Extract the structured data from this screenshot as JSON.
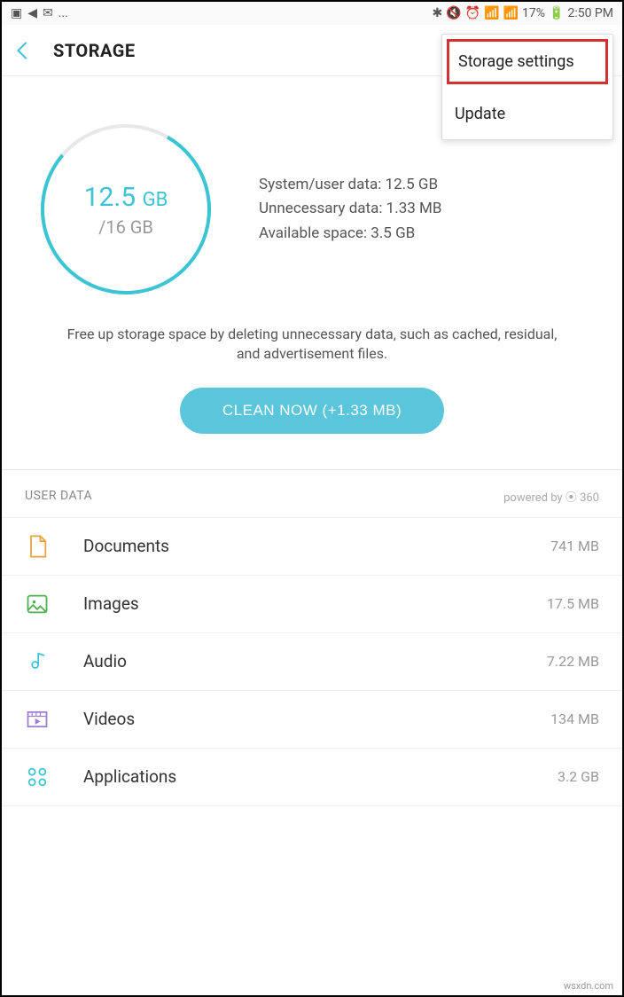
{
  "status_bar": {
    "battery_percent": "17%",
    "time": "2:50 PM"
  },
  "header": {
    "title": "STORAGE"
  },
  "popup": {
    "storage_settings": "Storage settings",
    "update": "Update"
  },
  "storage": {
    "used": "12.5",
    "used_unit": "GB",
    "total": "/16 GB",
    "system_label": "System/user data: 12.5 GB",
    "unnecessary_label": "Unnecessary data: 1.33 MB",
    "available_label": "Available space: 3.5 GB"
  },
  "hint": "Free up storage space by deleting unnecessary data, such as cached, residual, and advertisement files.",
  "clean_button": "CLEAN NOW (+1.33 MB)",
  "section": {
    "title": "USER DATA",
    "powered_by": "powered by ⦿ 360"
  },
  "user_data": [
    {
      "label": "Documents",
      "size": "741 MB"
    },
    {
      "label": "Images",
      "size": "17.5 MB"
    },
    {
      "label": "Audio",
      "size": "7.22 MB"
    },
    {
      "label": "Videos",
      "size": "134 MB"
    },
    {
      "label": "Applications",
      "size": "3.2 GB"
    }
  ],
  "watermark": "wsxdn.com"
}
